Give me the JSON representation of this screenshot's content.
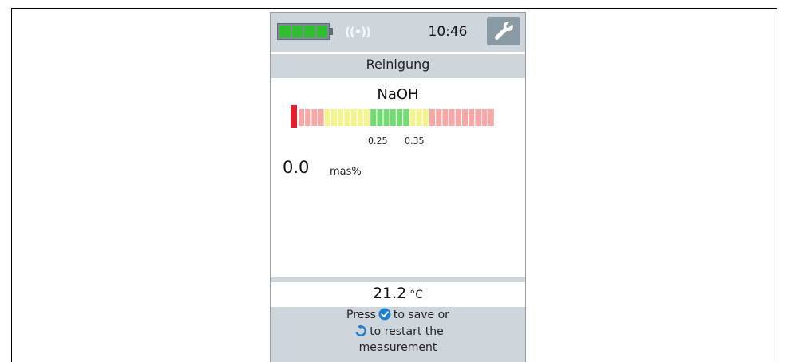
{
  "status": {
    "battery_icon": "battery-full-icon",
    "wireless_icon": "wireless-signal-icon",
    "wireless_glyph": "((•))",
    "time": "10:46",
    "settings_icon": "wrench-icon"
  },
  "screen": {
    "title": "Reinigung",
    "medium": "NaOH",
    "scale": {
      "tick_low": "0.25",
      "tick_high": "0.35",
      "colors": {
        "red": "#e0202e",
        "pink": "#f8a7a7",
        "yellow": "#f4f48e",
        "green": "#72dc72"
      }
    },
    "reading_value": "0.0",
    "reading_unit": "mas%"
  },
  "temperature": {
    "value": "21.2",
    "unit": "°C"
  },
  "prompt": {
    "part1": "Press",
    "confirm_icon": "checkmark-circle-icon",
    "part2": "to save or",
    "restart_icon": "restart-arrow-icon",
    "part3": "to restart the",
    "part4": "measurement"
  }
}
